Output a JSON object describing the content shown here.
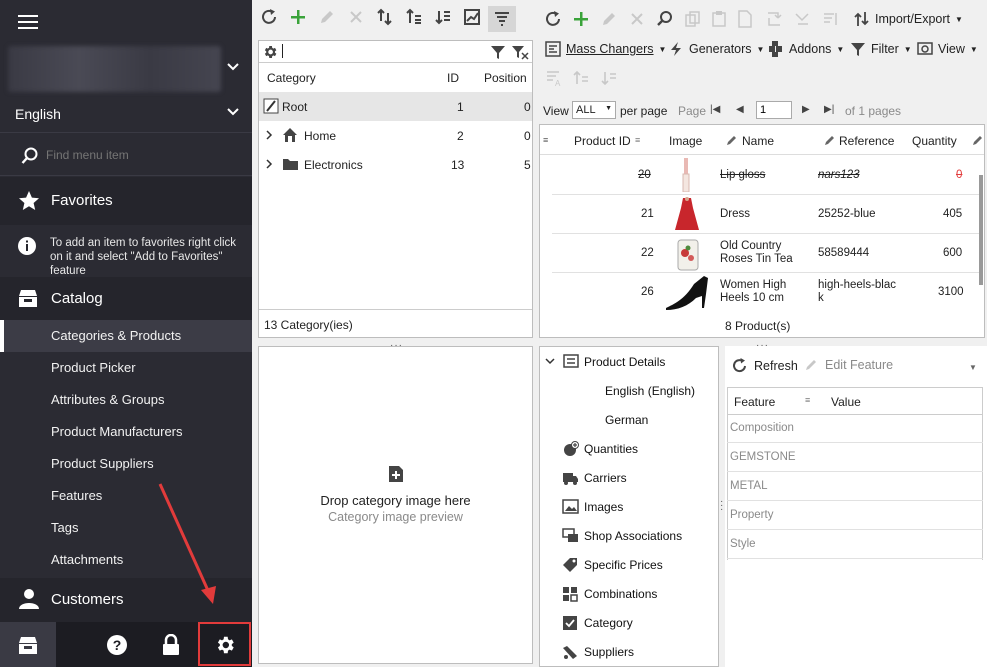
{
  "sidebar": {
    "language": "English",
    "search_placeholder": "Find menu item",
    "favorites_label": "Favorites",
    "favorites_tip": "To add an item to favorites right click on it and select \"Add to Favorites\" feature",
    "catalog_label": "Catalog",
    "items": [
      {
        "label": "Categories & Products",
        "active": true
      },
      {
        "label": "Product Picker",
        "active": false
      },
      {
        "label": "Attributes & Groups",
        "active": false
      },
      {
        "label": "Product Manufacturers",
        "active": false
      },
      {
        "label": "Product Suppliers",
        "active": false
      },
      {
        "label": "Features",
        "active": false
      },
      {
        "label": "Tags",
        "active": false
      },
      {
        "label": "Attachments",
        "active": false
      }
    ],
    "customers_label": "Customers"
  },
  "category_panel": {
    "columns": {
      "category": "Category",
      "id": "ID",
      "position": "Position"
    },
    "rows": [
      {
        "name": "Root",
        "id": "1",
        "position": "0"
      },
      {
        "name": "Home",
        "id": "2",
        "position": "0"
      },
      {
        "name": "Electronics",
        "id": "13",
        "position": "5"
      }
    ],
    "footer": "13 Category(ies)"
  },
  "image_panel": {
    "drop_text": "Drop category image here",
    "preview_text": "Category image preview"
  },
  "product_panel": {
    "import_export": "Import/Export",
    "mass_changers": "Mass Changers",
    "generators": "Generators",
    "addons": "Addons",
    "filter": "Filter",
    "view": "View",
    "view_label": "View",
    "per_page_value": "ALL",
    "per_page_label": "per page",
    "page_label": "Page",
    "page_value": "1",
    "of_pages": "of 1 pages",
    "columns": {
      "id": "Product ID",
      "image": "Image",
      "name": "Name",
      "reference": "Reference",
      "quantity": "Quantity"
    },
    "rows": [
      {
        "id": "20",
        "name": "Lip gloss",
        "reference": "nars123",
        "quantity": "0",
        "disabled": true
      },
      {
        "id": "21",
        "name": "Dress",
        "reference": "25252-blue",
        "quantity": "405",
        "disabled": false
      },
      {
        "id": "22",
        "name": "Old Country Roses Tin Tea",
        "reference": "58589444",
        "quantity": "600",
        "disabled": false
      },
      {
        "id": "26",
        "name": "Women High Heels 10 cm",
        "reference": "high-heels-black",
        "quantity": "3100",
        "disabled": false
      }
    ],
    "footer": "8 Product(s)"
  },
  "details_tree": {
    "root": "Product Details",
    "languages": [
      "English (English)",
      "German"
    ],
    "items": [
      {
        "label": "Quantities",
        "icon": "quantities-icon"
      },
      {
        "label": "Carriers",
        "icon": "truck-icon"
      },
      {
        "label": "Images",
        "icon": "image-icon"
      },
      {
        "label": "Shop Associations",
        "icon": "shop-icon"
      },
      {
        "label": "Specific Prices",
        "icon": "price-tag-icon"
      },
      {
        "label": "Combinations",
        "icon": "grid-icon"
      },
      {
        "label": "Category",
        "icon": "checkbox-icon"
      },
      {
        "label": "Suppliers",
        "icon": "supplier-icon"
      }
    ]
  },
  "features_panel": {
    "refresh": "Refresh",
    "edit_feature": "Edit Feature",
    "col_feature": "Feature",
    "col_value": "Value",
    "rows": [
      "Composition",
      "GEMSTONE",
      "METAL",
      "Property",
      "Style"
    ]
  },
  "colors": {
    "sidebar_bg": "#2b2b33",
    "accent_green": "#3aa33a",
    "highlight_red": "#e23b3b"
  }
}
